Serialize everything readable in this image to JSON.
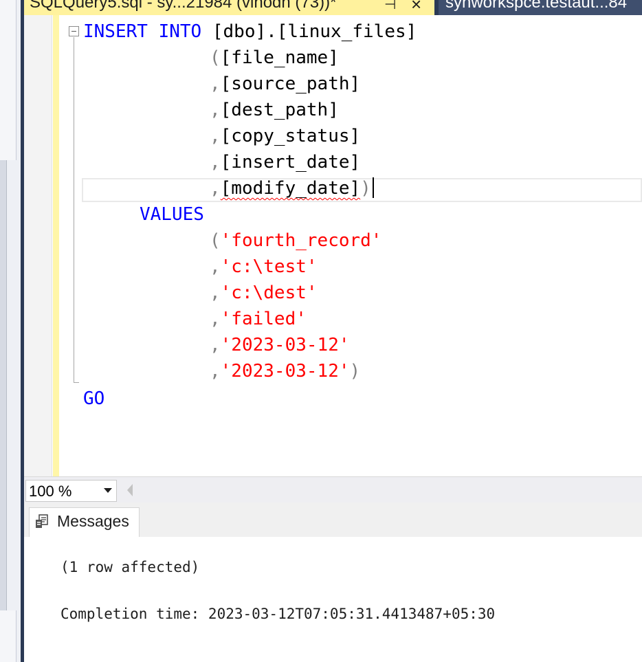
{
  "tabs": {
    "active_title": "SQLQuery5.sql - sy...21984 (vinodh (73))*",
    "pin_glyph": "⊣",
    "close_glyph": "×",
    "inactive_title": "synworkspce.testaut...84"
  },
  "editor": {
    "line1": {
      "insert": "INSERT",
      "into": "INTO",
      "table": "[dbo].[linux_files]"
    },
    "columns": [
      {
        "prefix": "(",
        "name": "[file_name]",
        "suffix": ""
      },
      {
        "prefix": ",",
        "name": "[source_path]",
        "suffix": ""
      },
      {
        "prefix": ",",
        "name": "[dest_path]",
        "suffix": ""
      },
      {
        "prefix": ",",
        "name": "[copy_status]",
        "suffix": ""
      },
      {
        "prefix": ",",
        "name": "[insert_date]",
        "suffix": ""
      },
      {
        "prefix": ",",
        "name": "[modify_date]",
        "suffix": ")"
      }
    ],
    "values_keyword": "VALUES",
    "values": [
      {
        "prefix": "(",
        "value": "'fourth_record'",
        "suffix": ""
      },
      {
        "prefix": ",",
        "value": "'c:\\test'",
        "suffix": ""
      },
      {
        "prefix": ",",
        "value": "'c:\\dest'",
        "suffix": ""
      },
      {
        "prefix": ",",
        "value": "'failed'",
        "suffix": ""
      },
      {
        "prefix": ",",
        "value": "'2023-03-12'",
        "suffix": ""
      },
      {
        "prefix": ",",
        "value": "'2023-03-12'",
        "suffix": ")"
      }
    ],
    "go_keyword": "GO"
  },
  "zoom": {
    "value": "100 %"
  },
  "results": {
    "tab_label": "Messages",
    "rows_affected": "(1 row affected)",
    "completion": "Completion time: 2023-03-12T07:05:31.4413487+05:30"
  },
  "colors": {
    "keyword": "#0000ff",
    "string": "#ff0000",
    "operator": "#808080",
    "active_tab": "#fff29d",
    "tab_strip": "#2b3a55"
  }
}
